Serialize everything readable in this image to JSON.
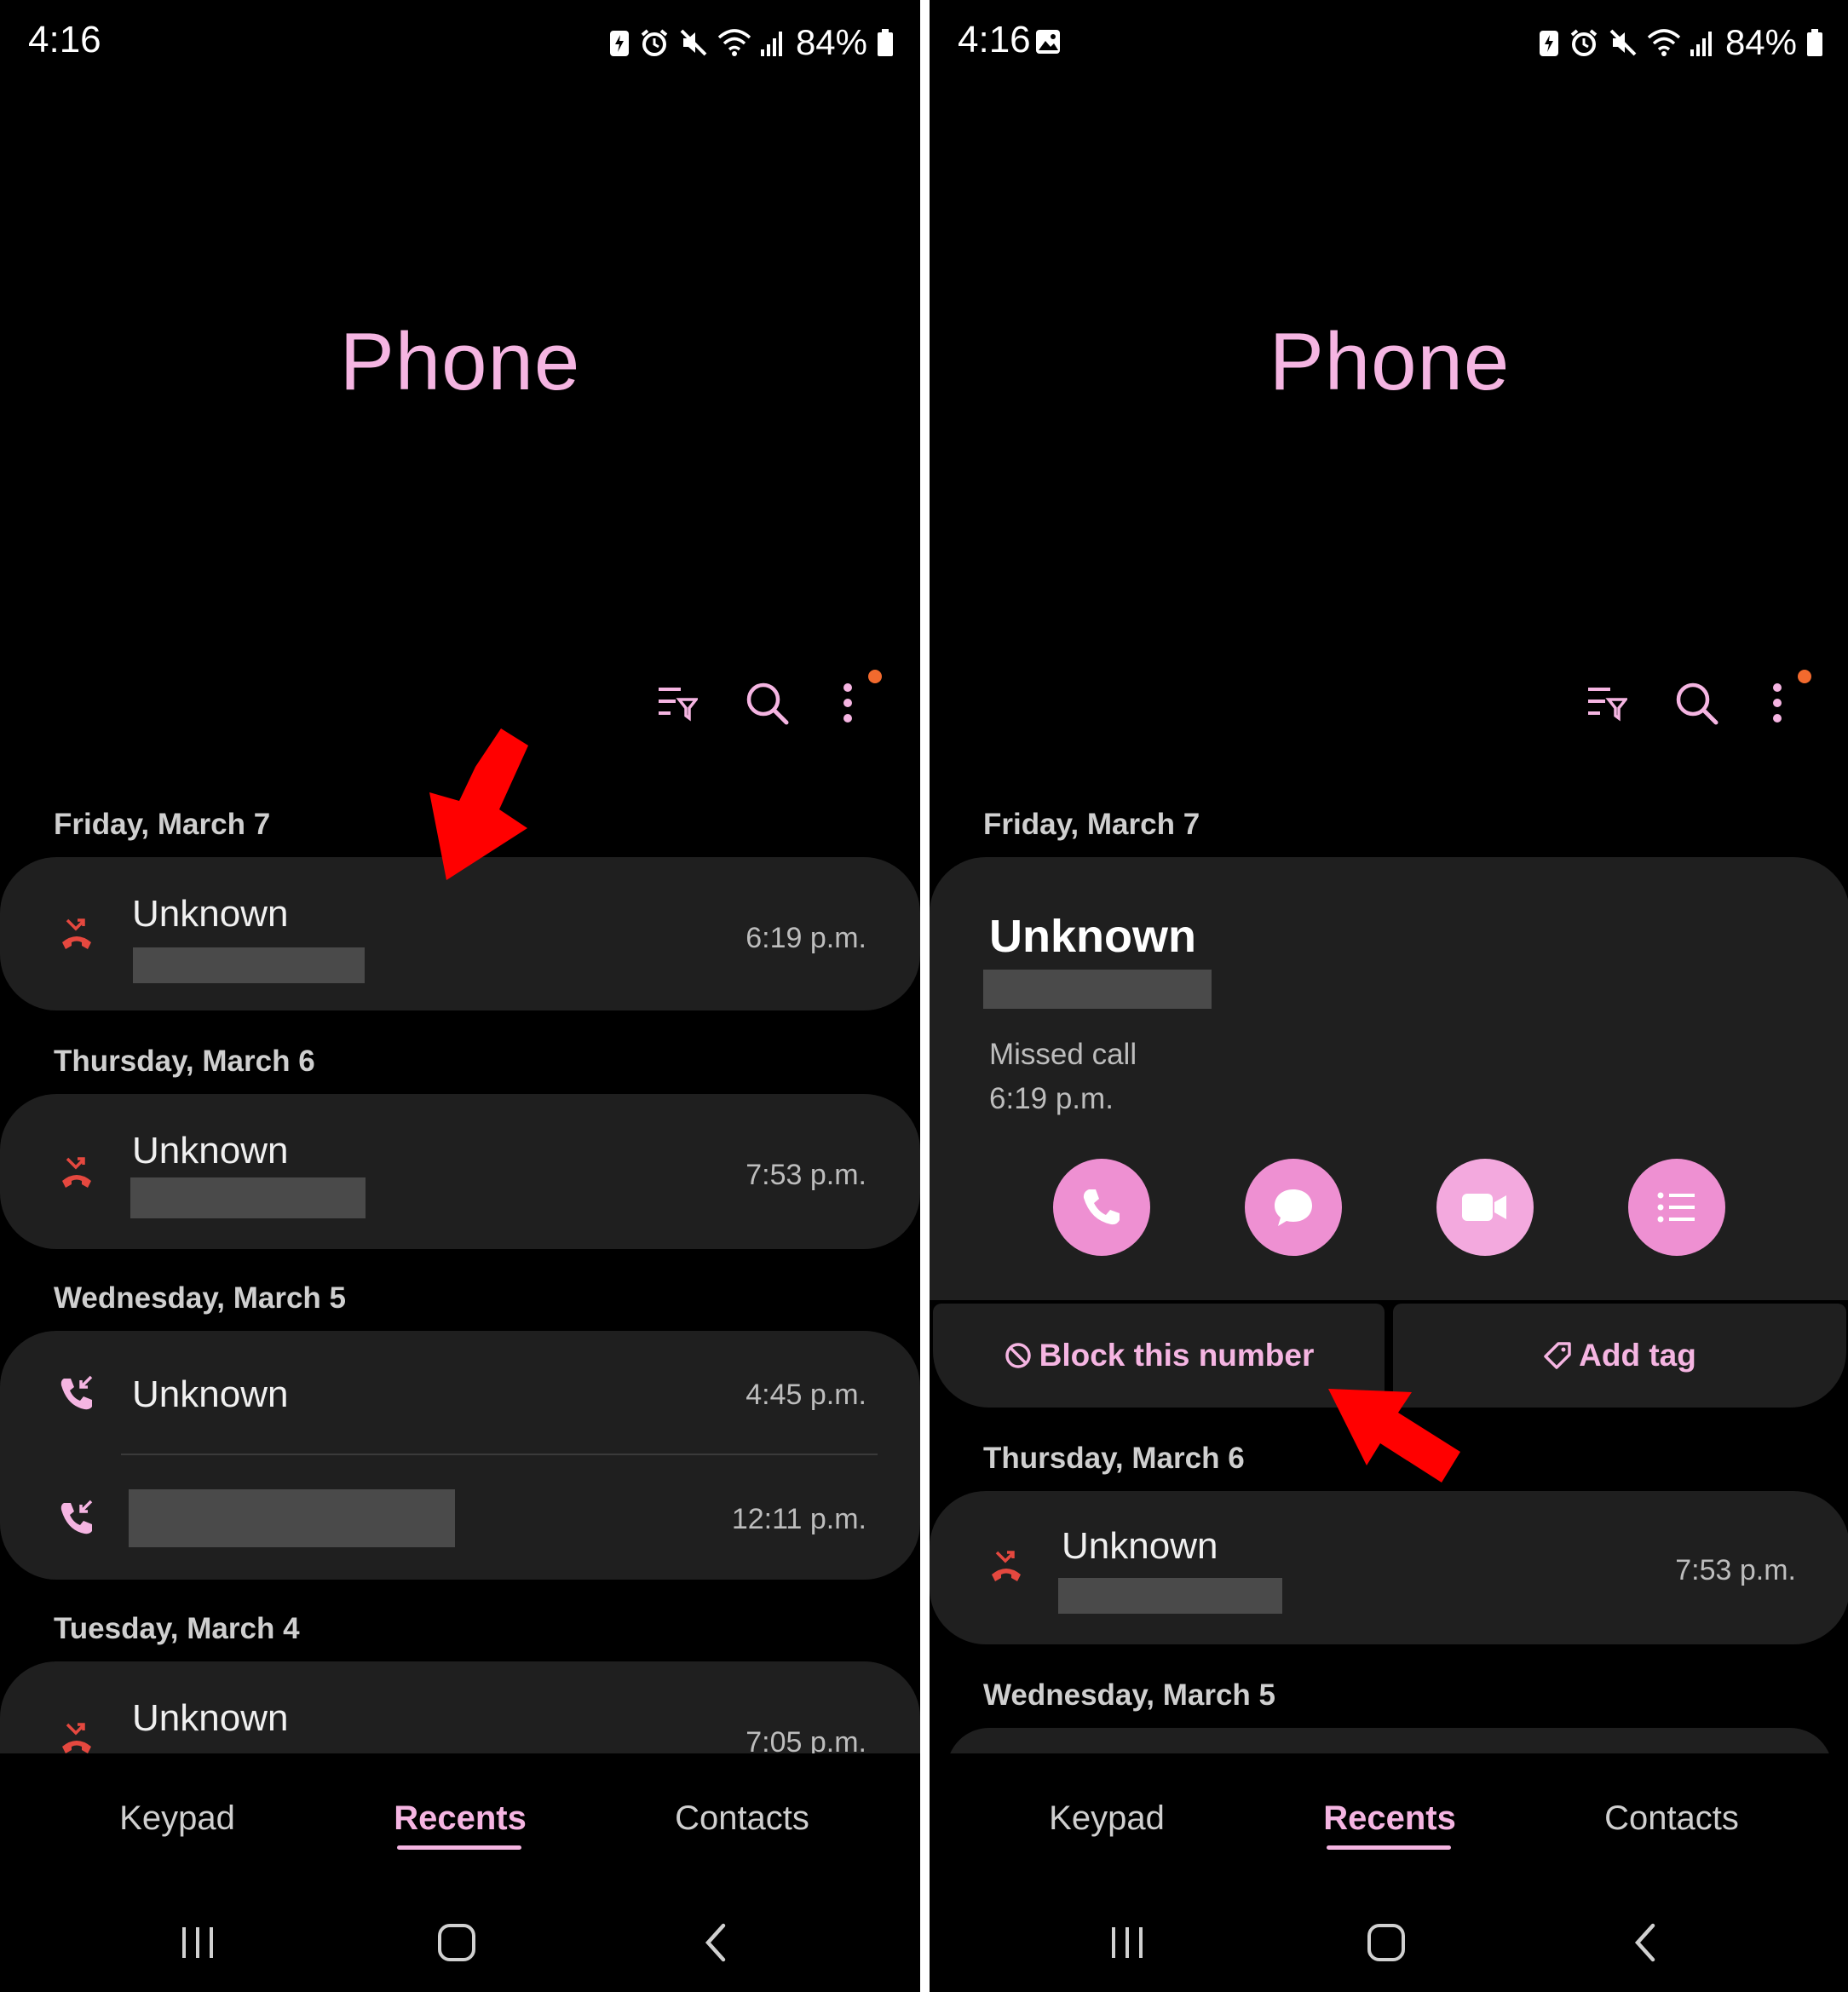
{
  "left": {
    "status": {
      "time": "4:16",
      "battery": "84%"
    },
    "title": "Phone",
    "groups": [
      {
        "date": "Friday, March 7",
        "calls": [
          {
            "name": "Unknown",
            "time": "6:19 p.m.",
            "type": "missed"
          }
        ]
      },
      {
        "date": "Thursday, March 6",
        "calls": [
          {
            "name": "Unknown",
            "time": "7:53 p.m.",
            "type": "missed"
          }
        ]
      },
      {
        "date": "Wednesday, March 5",
        "calls": [
          {
            "name": "Unknown",
            "time": "4:45 p.m.",
            "type": "incoming"
          },
          {
            "name": "",
            "time": "12:11 p.m.",
            "type": "incoming"
          }
        ]
      },
      {
        "date": "Tuesday, March 4",
        "calls": [
          {
            "name": "Unknown",
            "time": "7:05 p.m.",
            "type": "missed"
          }
        ]
      }
    ],
    "tabs": [
      "Keypad",
      "Recents",
      "Contacts"
    ],
    "active_tab": "Recents"
  },
  "right": {
    "status": {
      "time": "4:16",
      "battery": "84%"
    },
    "title": "Phone",
    "expanded": {
      "date": "Friday, March 7",
      "name": "Unknown",
      "status": "Missed call",
      "time": "6:19 p.m.",
      "actions": [
        "phone-icon",
        "message-icon",
        "video-call-icon",
        "details-list-icon"
      ],
      "block_label": "Block this number",
      "tag_label": "Add tag"
    },
    "groups": [
      {
        "date": "Thursday, March 6",
        "calls": [
          {
            "name": "Unknown",
            "time": "7:53 p.m.",
            "type": "missed"
          }
        ]
      },
      {
        "date": "Wednesday, March 5",
        "calls": []
      }
    ],
    "tabs": [
      "Keypad",
      "Recents",
      "Contacts"
    ],
    "active_tab": "Recents"
  },
  "colors": {
    "accent_pink": "#f5b5e2",
    "button_pink": "#ee90d2",
    "missed_red": "#e5483f",
    "notification_dot": "#f26a2e",
    "annotation_arrow": "#ff0000",
    "card_bg": "#1f1f1f"
  }
}
